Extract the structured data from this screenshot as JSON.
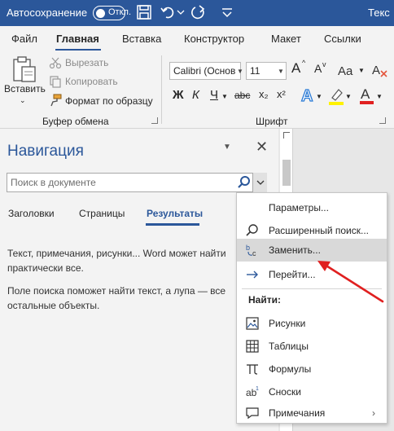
{
  "titlebar": {
    "autosave_label": "Автосохранение",
    "autosave_state": "Откл.",
    "doc_title": "Текс"
  },
  "ribbon_tabs": [
    {
      "label": "Файл",
      "active": false
    },
    {
      "label": "Главная",
      "active": true
    },
    {
      "label": "Вставка",
      "active": false
    },
    {
      "label": "Конструктор",
      "active": false
    },
    {
      "label": "Макет",
      "active": false
    },
    {
      "label": "Ссылки",
      "active": false
    }
  ],
  "clipboard": {
    "paste_label": "Вставить",
    "cut_label": "Вырезать",
    "copy_label": "Копировать",
    "format_painter_label": "Формат по образцу",
    "group_label": "Буфер обмена"
  },
  "font": {
    "font_name": "Calibri (Основ",
    "font_size": "11",
    "grow_label": "A",
    "shrink_label": "A",
    "bold": "Ж",
    "italic": "К",
    "underline": "Ч",
    "strike": "abc",
    "subscript": "x₂",
    "superscript": "x²",
    "group_label": "Шрифт"
  },
  "navigation": {
    "title": "Навигация",
    "search_placeholder": "Поиск в документе",
    "tabs": [
      {
        "label": "Заголовки",
        "active": false
      },
      {
        "label": "Страницы",
        "active": false
      },
      {
        "label": "Результаты",
        "active": true
      }
    ],
    "info_text_1": "Текст, примечания, рисунки... Word может найти практически все.",
    "info_text_2": "Поле поиска поможет найти текст, а лупа — все остальные объекты."
  },
  "dropdown": {
    "items": [
      {
        "label": "Параметры...",
        "icon": "none"
      },
      {
        "label": "Расширенный поиск...",
        "icon": "search-icon"
      },
      {
        "label": "Заменить...",
        "icon": "replace-icon",
        "hovered": true
      },
      {
        "label": "Перейти...",
        "icon": "arrow-right-icon"
      }
    ],
    "find_header": "Найти:",
    "find_items": [
      {
        "label": "Рисунки",
        "icon": "image-icon"
      },
      {
        "label": "Таблицы",
        "icon": "table-icon"
      },
      {
        "label": "Формулы",
        "icon": "pi-icon"
      },
      {
        "label": "Сноски",
        "icon": "footnote-icon"
      },
      {
        "label": "Примечания",
        "icon": "comment-icon",
        "submenu": true
      }
    ]
  },
  "colors": {
    "accent": "#2b579a",
    "annotation": "#e02020",
    "hover": "#d9d9d9"
  }
}
